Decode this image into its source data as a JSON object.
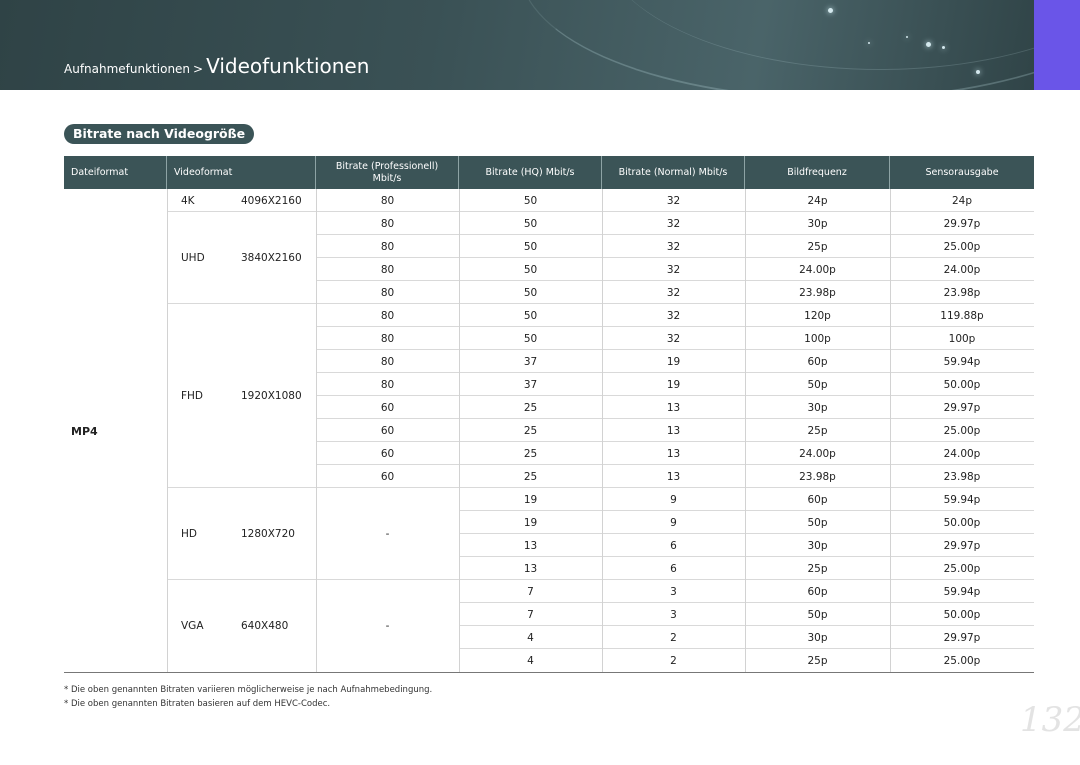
{
  "header": {
    "breadcrumb_parent": "Aufnahmefunktionen",
    "breadcrumb_separator": ">",
    "breadcrumb_current": "Videofunktionen",
    "accent_color": "#6a55e8",
    "banner_color": "#3b5457"
  },
  "section": {
    "title": "Bitrate nach Videogröße"
  },
  "table": {
    "headers": {
      "dateiformat": "Dateiformat",
      "videoformat": "Videoformat",
      "bitrate_pro_line1": "Bitrate (Professionell)",
      "bitrate_pro_line2": "Mbit/s",
      "bitrate_hq": "Bitrate (HQ) Mbit/s",
      "bitrate_normal": "Bitrate (Normal) Mbit/s",
      "bildfrequenz": "Bildfrequenz",
      "sensorausgabe": "Sensorausgabe"
    },
    "file_format": "MP4",
    "groups": [
      {
        "name": "4K",
        "resolution": "4096X2160",
        "rows": [
          {
            "pro": "80",
            "hq": "50",
            "normal": "32",
            "fps": "24p",
            "sensor": "24p"
          }
        ]
      },
      {
        "name": "UHD",
        "resolution": "3840X2160",
        "rows": [
          {
            "pro": "80",
            "hq": "50",
            "normal": "32",
            "fps": "30p",
            "sensor": "29.97p"
          },
          {
            "pro": "80",
            "hq": "50",
            "normal": "32",
            "fps": "25p",
            "sensor": "25.00p"
          },
          {
            "pro": "80",
            "hq": "50",
            "normal": "32",
            "fps": "24.00p",
            "sensor": "24.00p"
          },
          {
            "pro": "80",
            "hq": "50",
            "normal": "32",
            "fps": "23.98p",
            "sensor": "23.98p"
          }
        ]
      },
      {
        "name": "FHD",
        "resolution": "1920X1080",
        "rows": [
          {
            "pro": "80",
            "hq": "50",
            "normal": "32",
            "fps": "120p",
            "sensor": "119.88p"
          },
          {
            "pro": "80",
            "hq": "50",
            "normal": "32",
            "fps": "100p",
            "sensor": "100p"
          },
          {
            "pro": "80",
            "hq": "37",
            "normal": "19",
            "fps": "60p",
            "sensor": "59.94p"
          },
          {
            "pro": "80",
            "hq": "37",
            "normal": "19",
            "fps": "50p",
            "sensor": "50.00p"
          },
          {
            "pro": "60",
            "hq": "25",
            "normal": "13",
            "fps": "30p",
            "sensor": "29.97p"
          },
          {
            "pro": "60",
            "hq": "25",
            "normal": "13",
            "fps": "25p",
            "sensor": "25.00p"
          },
          {
            "pro": "60",
            "hq": "25",
            "normal": "13",
            "fps": "24.00p",
            "sensor": "24.00p"
          },
          {
            "pro": "60",
            "hq": "25",
            "normal": "13",
            "fps": "23.98p",
            "sensor": "23.98p"
          }
        ]
      },
      {
        "name": "HD",
        "resolution": "1280X720",
        "pro_merged": "-",
        "rows": [
          {
            "hq": "19",
            "normal": "9",
            "fps": "60p",
            "sensor": "59.94p"
          },
          {
            "hq": "19",
            "normal": "9",
            "fps": "50p",
            "sensor": "50.00p"
          },
          {
            "hq": "13",
            "normal": "6",
            "fps": "30p",
            "sensor": "29.97p"
          },
          {
            "hq": "13",
            "normal": "6",
            "fps": "25p",
            "sensor": "25.00p"
          }
        ]
      },
      {
        "name": "VGA",
        "resolution": "640X480",
        "pro_merged": "-",
        "rows": [
          {
            "hq": "7",
            "normal": "3",
            "fps": "60p",
            "sensor": "59.94p"
          },
          {
            "hq": "7",
            "normal": "3",
            "fps": "50p",
            "sensor": "50.00p"
          },
          {
            "hq": "4",
            "normal": "2",
            "fps": "30p",
            "sensor": "29.97p"
          },
          {
            "hq": "4",
            "normal": "2",
            "fps": "25p",
            "sensor": "25.00p"
          }
        ]
      }
    ]
  },
  "footnotes": [
    "* Die oben genannten Bitraten variieren möglicherweise je nach Aufnahmebedingung.",
    "* Die oben genannten Bitraten basieren auf dem HEVC-Codec."
  ],
  "page_number": "132"
}
